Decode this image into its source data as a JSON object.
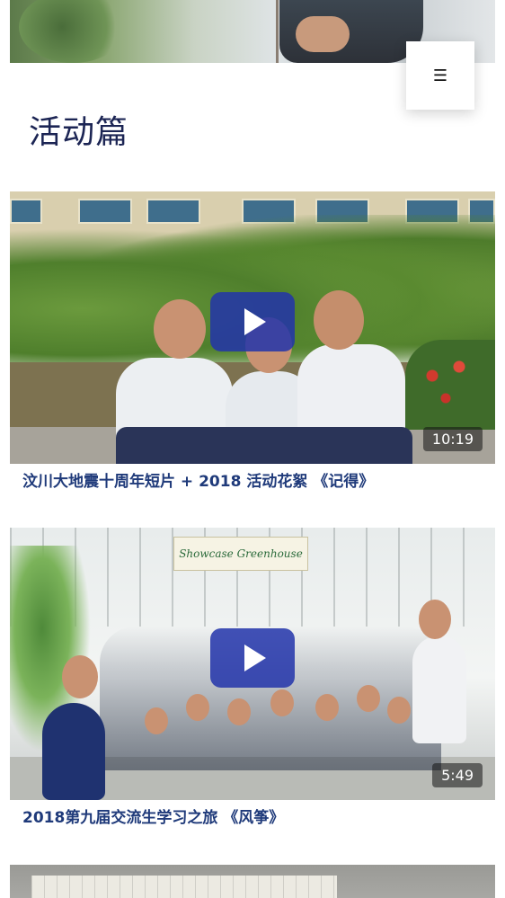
{
  "header": {
    "menu_icon": "hamburger-icon",
    "menu_glyph": "☰"
  },
  "section": {
    "title": "活动篇"
  },
  "videos": [
    {
      "title": "汶川大地震十周年短片 + 2018 活动花絮 《记得》",
      "duration": "10:19"
    },
    {
      "title": "2018第九届交流生学习之旅 《风筝》",
      "duration": "5:49",
      "sign_text": "Showcase Greenhouse"
    }
  ],
  "colors": {
    "title": "#1c2554",
    "caption": "#1f3a7a",
    "play_button": "#2234aa"
  }
}
